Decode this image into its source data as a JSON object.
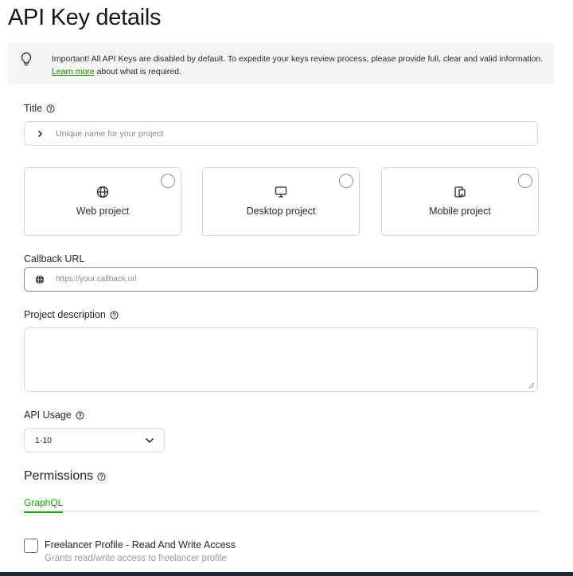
{
  "page": {
    "title": "API Key details"
  },
  "notice": {
    "text_before": "Important! All API Keys are disabled by default. To expedite your keys review process, please provide full, clear and valid information. ",
    "link_text": "Learn more",
    "text_after": " about what is required."
  },
  "title_field": {
    "label": "Title",
    "placeholder": "Unique name for your project"
  },
  "project_types": [
    {
      "label": "Web project",
      "icon": "globe-icon"
    },
    {
      "label": "Desktop project",
      "icon": "monitor-icon"
    },
    {
      "label": "Mobile project",
      "icon": "mobile-icon"
    }
  ],
  "callback_field": {
    "label": "Callback URL",
    "placeholder": "https://your.callback.url"
  },
  "description_field": {
    "label": "Project description"
  },
  "usage_field": {
    "label": "API Usage",
    "selected": "1-10"
  },
  "permissions": {
    "heading": "Permissions",
    "tabs": [
      {
        "label": "GraphQL",
        "active": true
      }
    ],
    "items": [
      {
        "title": "Freelancer Profile - Read And Write Access",
        "description": "Grants read/write access to freelancer profile",
        "checked": false
      }
    ]
  },
  "colors": {
    "accent": "#14a800",
    "link": "#108a00",
    "notice_bg": "#f3f4f3"
  }
}
